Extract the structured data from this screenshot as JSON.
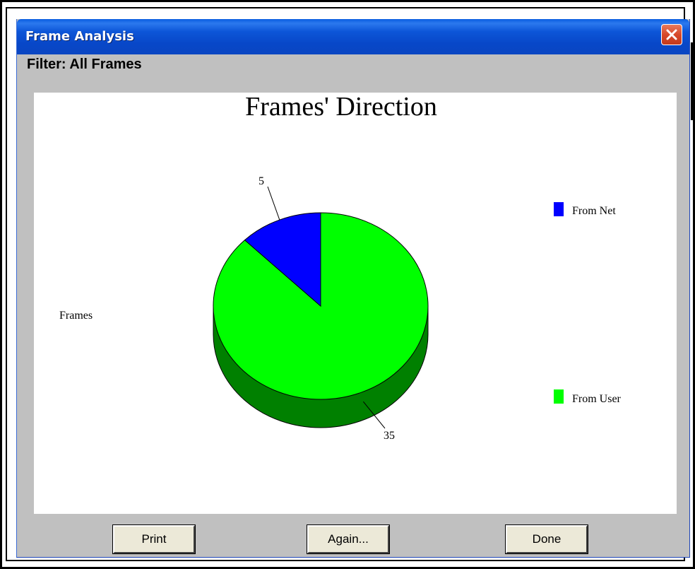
{
  "window": {
    "title": "Frame Analysis",
    "filter_label": "Filter: All Frames"
  },
  "buttons": {
    "print_label": "Print",
    "again_label": "Again...",
    "done_label": "Done",
    "close_icon": "close-x-icon"
  },
  "colors": {
    "title_bar": "#0a46c2",
    "close_button": "#d7492a",
    "from_net": "#0000ff",
    "from_user": "#00ff00",
    "from_user_side": "#008000"
  },
  "chart_data": {
    "type": "pie",
    "title": "Frames' Direction",
    "ylabel": "Frames",
    "categories": [
      "From Net",
      "From User"
    ],
    "values": [
      5,
      35
    ],
    "data_labels": [
      "5",
      "35"
    ],
    "legend": [
      "From Net",
      "From User"
    ],
    "legend_placement": "right",
    "three_d": true
  }
}
